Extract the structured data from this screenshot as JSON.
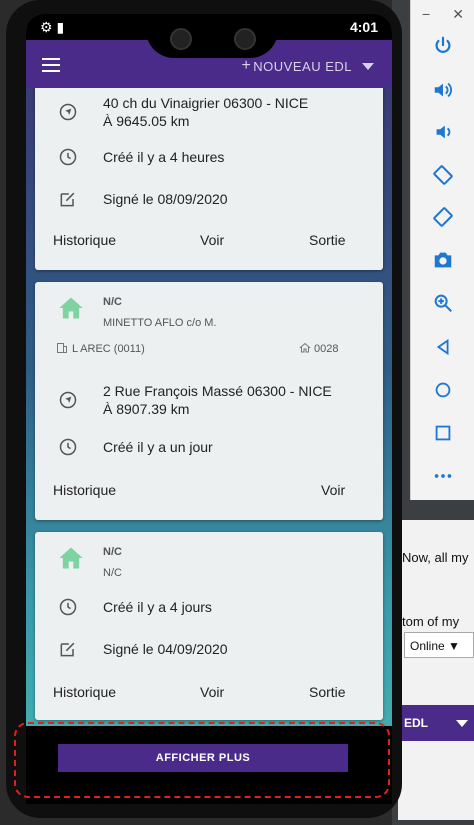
{
  "status": {
    "time": "4:01"
  },
  "appbar": {
    "new_label": "NOUVEAU EDL"
  },
  "cards": [
    {
      "address_line1": "40 ch du Vinaigrier 06300 - NICE",
      "address_line2": "À 9645.05 km",
      "created": "Créé il y a 4 heures",
      "signed": "Signé le 08/09/2020",
      "actions": {
        "history": "Historique",
        "view": "Voir",
        "exit": "Sortie"
      }
    },
    {
      "type": "N/C",
      "owner": "MINETTO AFLO c/o M.",
      "lot": "L AREC (0011)",
      "number": "0028",
      "address_line1": "2 Rue François Massé 06300 - NICE",
      "address_line2": "À 8907.39 km",
      "created": "Créé il y a un jour",
      "actions": {
        "history": "Historique",
        "view": "Voir"
      }
    },
    {
      "type": "N/C",
      "owner": "N/C",
      "created": "Créé il y a 4 jours",
      "signed": "Signé le 04/09/2020",
      "actions": {
        "history": "Historique",
        "view": "Voir",
        "exit": "Sortie"
      }
    }
  ],
  "more_button": "AFFICHER PLUS",
  "background": {
    "text1": "Now, all my",
    "text2": "tom of my",
    "online_select": "Online ▼",
    "mini_bar": "EDL"
  },
  "colors": {
    "primary": "#4a2b8a",
    "card": "#edf0f0",
    "house": "#7fd3a0",
    "toolbar_icon": "#1e77d0"
  }
}
